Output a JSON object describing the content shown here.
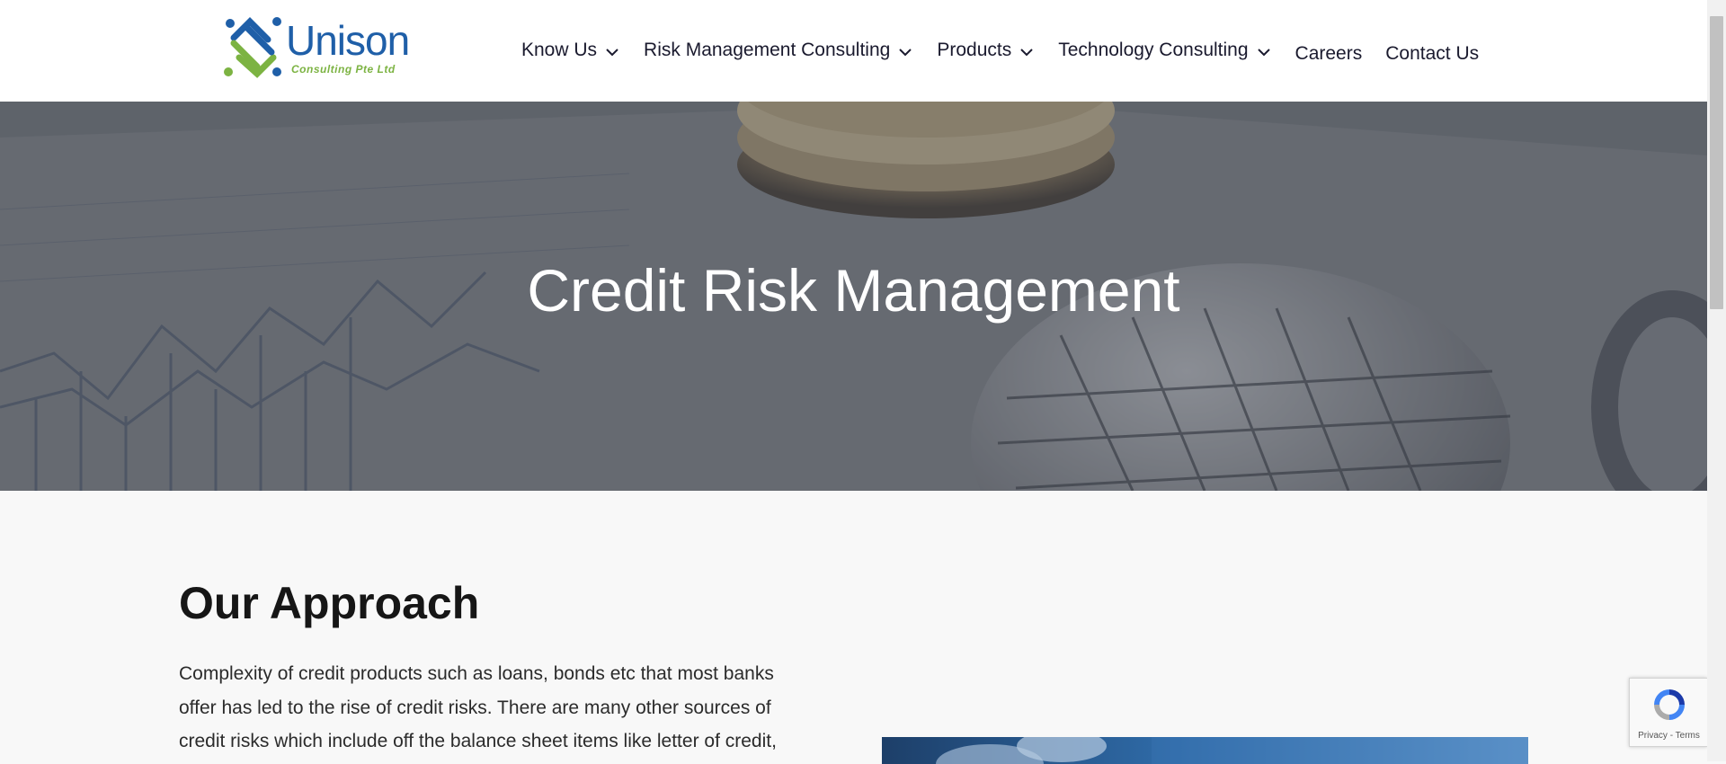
{
  "brand": {
    "name": "Unison",
    "tagline": "Consulting Pte Ltd",
    "colors": {
      "blue": "#1f5fa8",
      "green": "#7cb342"
    }
  },
  "nav": {
    "items": [
      {
        "label": "Know Us",
        "has_dropdown": true
      },
      {
        "label": "Risk Management Consulting",
        "has_dropdown": true
      },
      {
        "label": "Products",
        "has_dropdown": true
      },
      {
        "label": "Technology Consulting",
        "has_dropdown": true
      },
      {
        "label": "Careers",
        "has_dropdown": false
      },
      {
        "label": "Contact Us",
        "has_dropdown": false
      }
    ]
  },
  "hero": {
    "title": "Credit Risk Management"
  },
  "approach": {
    "title": "Our Approach",
    "lines": [
      "Complexity of credit products such as loans, bonds etc that most banks",
      "offer has led to the rise of credit risks. There are many other sources of",
      "credit risks which include off the balance sheet items like letter of credit,"
    ]
  },
  "recaptcha": {
    "links": "Privacy - Terms"
  },
  "icons": {
    "chevron": "chevron-down-icon",
    "recaptcha": "recaptcha-icon"
  }
}
